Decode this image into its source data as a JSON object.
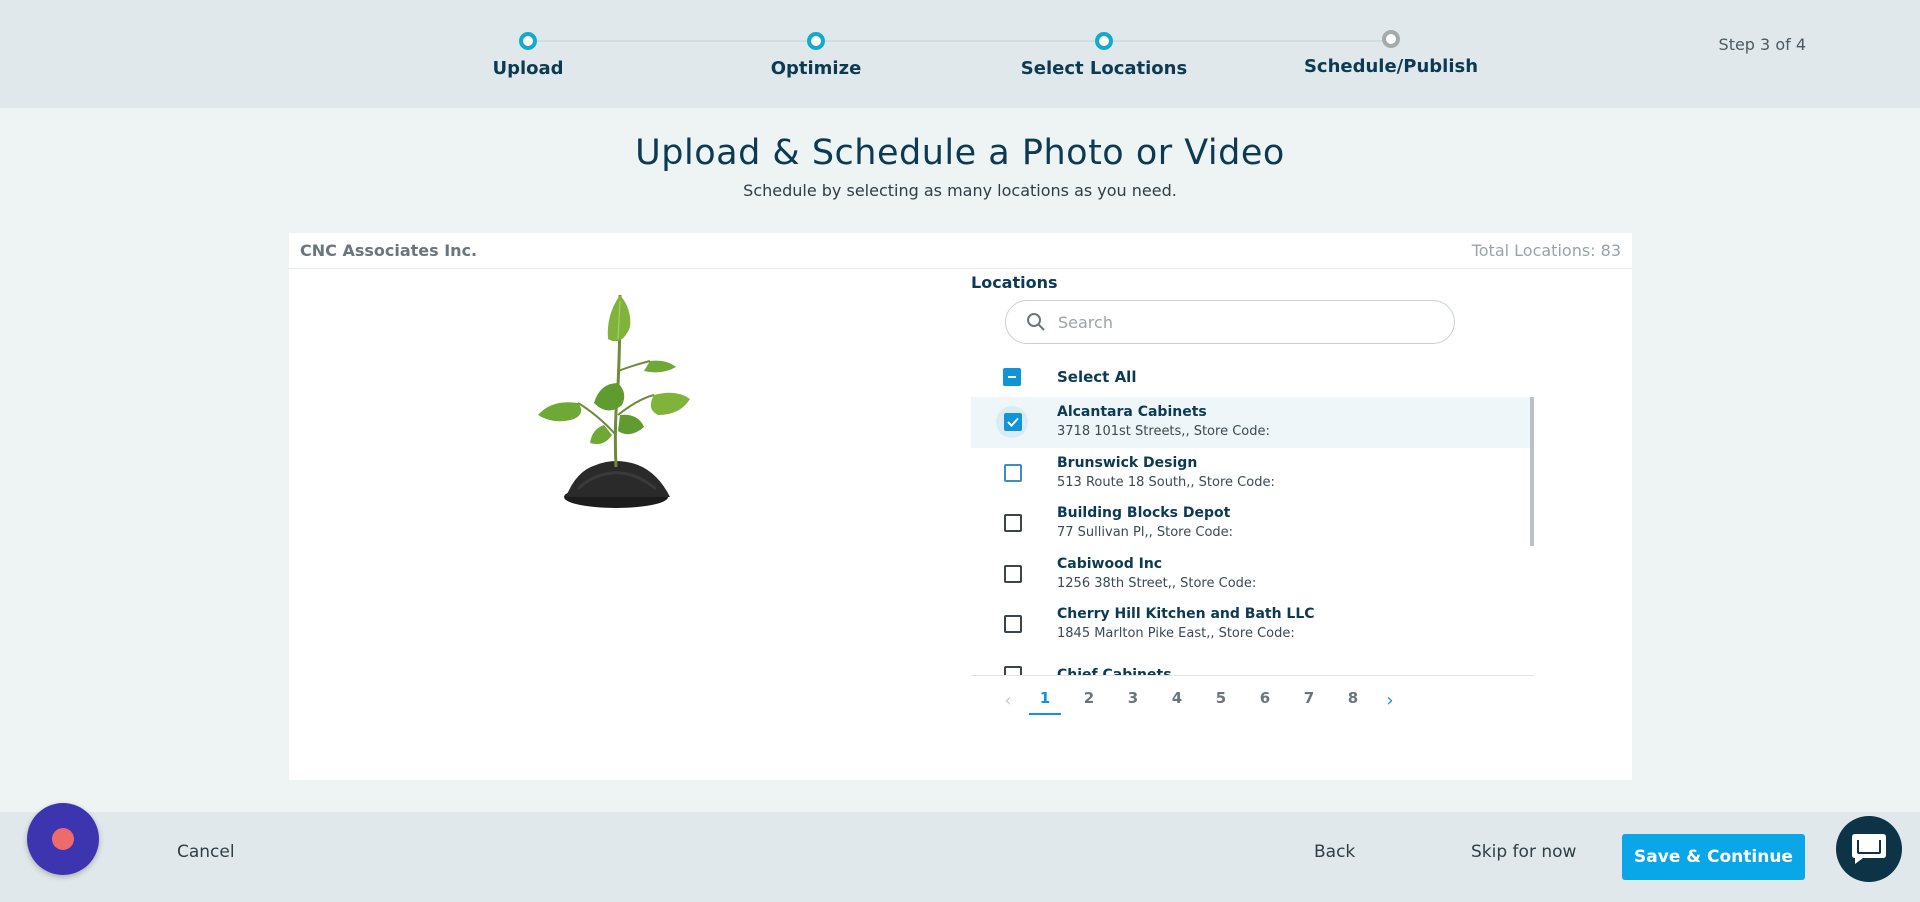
{
  "stepper": {
    "steps": [
      {
        "label": "Upload",
        "state": "complete"
      },
      {
        "label": "Optimize",
        "state": "complete"
      },
      {
        "label": "Select Locations",
        "state": "current"
      },
      {
        "label": "Schedule/Publish",
        "state": "pending"
      }
    ],
    "step_count": "Step 3 of 4"
  },
  "header": {
    "title": "Upload & Schedule a Photo or Video",
    "subtitle": "Schedule by selecting as many locations as you need."
  },
  "card": {
    "account_name": "CNC Associates Inc.",
    "total_locations": "Total Locations: 83"
  },
  "locations": {
    "title": "Locations",
    "search_placeholder": "Search",
    "search_value": "",
    "select_all_label": "Select All",
    "items": [
      {
        "name": "Alcantara Cabinets",
        "address": "3718 101st Streets,, Store Code:",
        "checked": true
      },
      {
        "name": "Brunswick Design",
        "address": "513 Route 18 South,, Store Code:",
        "checked": false
      },
      {
        "name": "Building Blocks Depot",
        "address": "77 Sullivan Pl,, Store Code:",
        "checked": false
      },
      {
        "name": "Cabiwood Inc",
        "address": "1256 38th Street,, Store Code:",
        "checked": false
      },
      {
        "name": "Cherry Hill Kitchen and Bath LLC",
        "address": "1845 Marlton Pike East,, Store Code:",
        "checked": false
      },
      {
        "name": "Chief Cabinets",
        "address": "",
        "checked": false
      }
    ]
  },
  "pagination": {
    "pages": [
      "1",
      "2",
      "3",
      "4",
      "5",
      "6",
      "7",
      "8"
    ],
    "current": "1",
    "prev_icon": "chevron-left-icon",
    "next_icon": "chevron-right-icon"
  },
  "footer": {
    "cancel_label": "Cancel",
    "back_label": "Back",
    "skip_label": "Skip for now",
    "save_label": "Save & Continue"
  },
  "colors": {
    "accent": "#0aa7e8",
    "step_complete": "#14a9d0",
    "navy_text": "#0b3a52",
    "record_button": "#3d34b0",
    "chat_button": "#0c3346"
  }
}
